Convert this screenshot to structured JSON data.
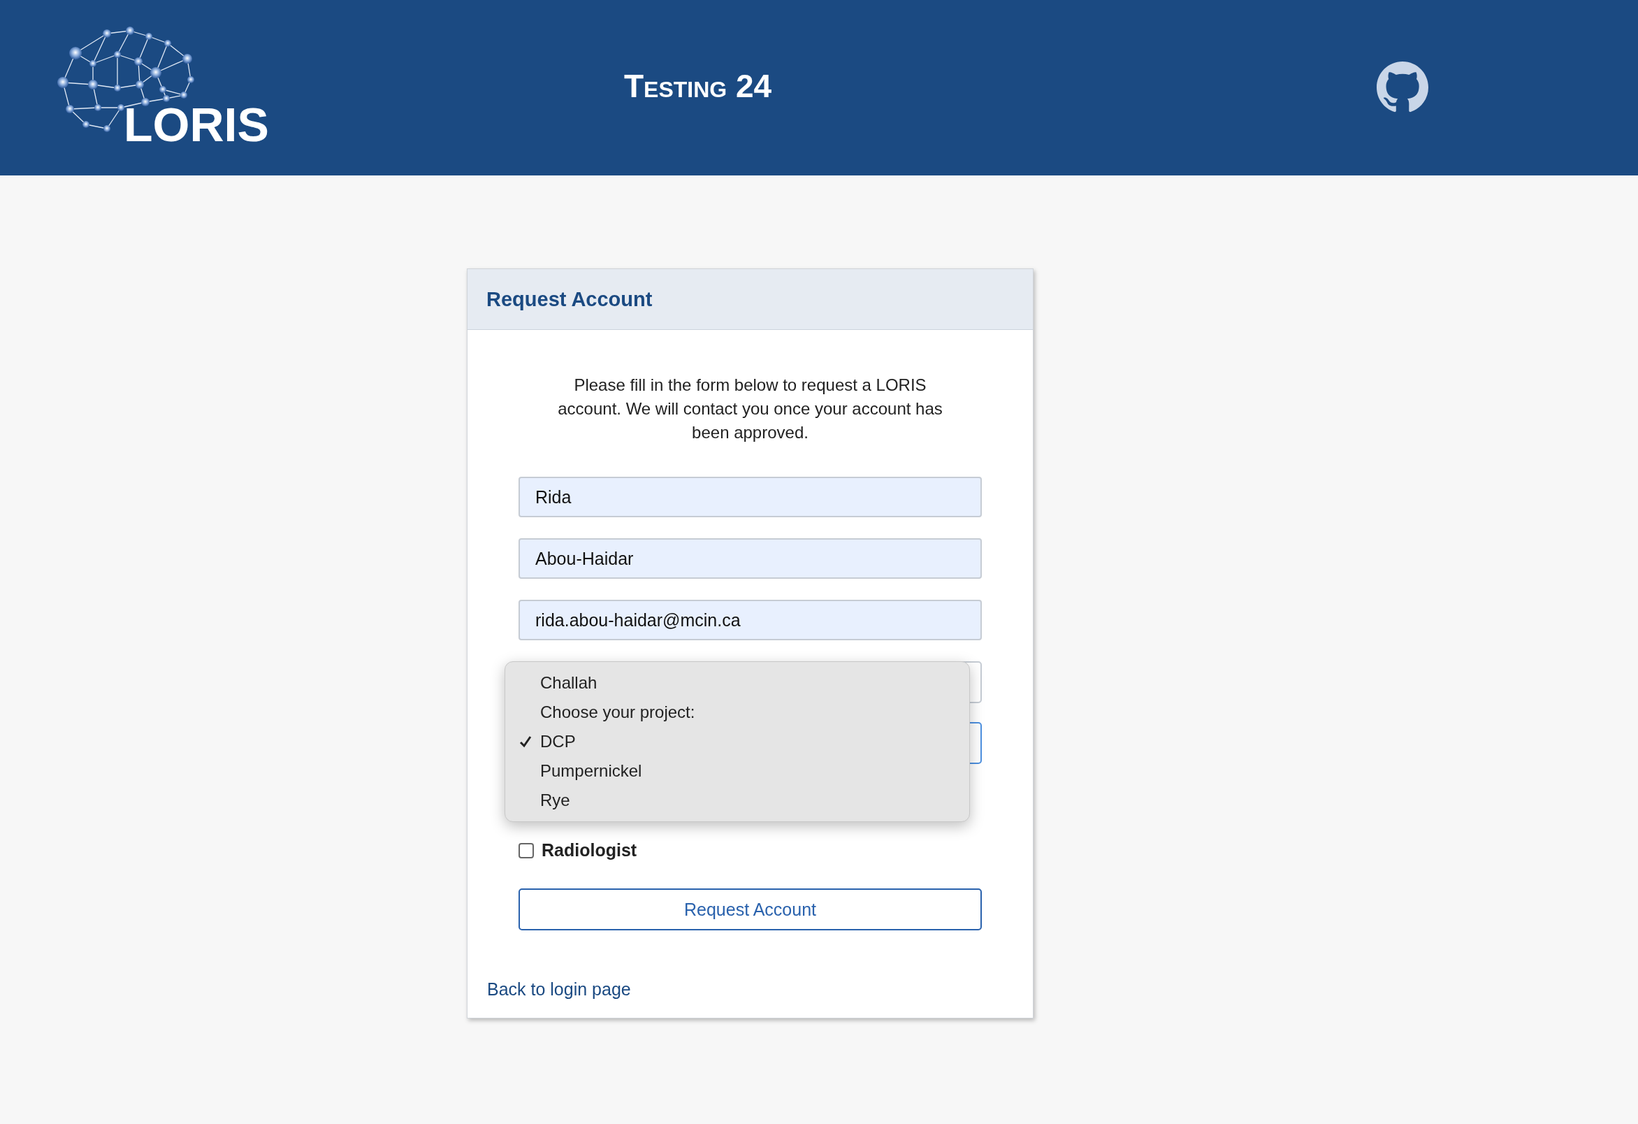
{
  "header": {
    "logo_text": "LORIS",
    "title": "Testing 24"
  },
  "card": {
    "title": "Request Account",
    "intro": "Please fill in the form below to request a LORIS account. We will contact you once your account has been approved.",
    "fields": [
      {
        "value": "Rida"
      },
      {
        "value": "Abou-Haidar"
      },
      {
        "value": "rida.abou-haidar@mcin.ca"
      }
    ],
    "selects": [
      {
        "focused": false
      },
      {
        "focused": true
      }
    ],
    "dropdown": {
      "options": [
        {
          "label": "Challah",
          "selected": false
        },
        {
          "label": "Choose your project:",
          "selected": false
        },
        {
          "label": "DCP",
          "selected": true
        },
        {
          "label": "Pumpernickel",
          "selected": false
        },
        {
          "label": "Rye",
          "selected": false
        }
      ]
    },
    "checkbox": {
      "label": "Radiologist",
      "checked": false
    },
    "submit": "Request Account",
    "back_link": "Back to login page"
  }
}
